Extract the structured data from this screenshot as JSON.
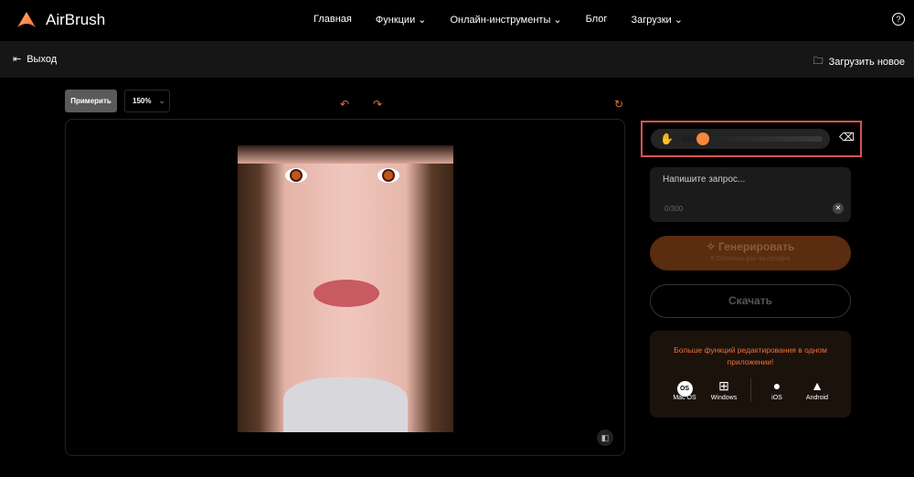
{
  "header": {
    "brand": "AirBrush",
    "nav": [
      {
        "label": "Главная"
      },
      {
        "label": "Функции ⌄"
      },
      {
        "label": "Онлайн-инструменты ⌄"
      },
      {
        "label": "Блог"
      },
      {
        "label": "Загрузки ⌄"
      }
    ],
    "help_icon": "question-circle-icon"
  },
  "toolbar": {
    "exit_label": "Выход",
    "upload_label": "Загрузить новое"
  },
  "editor": {
    "try_label": "Примерить",
    "zoom_value": "150%"
  },
  "brush": {
    "size_percent": 15,
    "accent": "#f7873a"
  },
  "prompt": {
    "placeholder": "Напишите запрос...",
    "counter": "0/300"
  },
  "generate": {
    "label": "Генерировать",
    "remaining": "5 Осталось раз на сегодня"
  },
  "download_label": "Скачать",
  "promo": {
    "text": "Больше функций редактирования в одном приложении!",
    "platforms": [
      {
        "label": "Mac OS",
        "icon": "OS"
      },
      {
        "label": "Windows",
        "icon": "⊞"
      },
      {
        "label": "iOS",
        "icon": ""
      },
      {
        "label": "Android",
        "icon": "🤖"
      }
    ]
  }
}
